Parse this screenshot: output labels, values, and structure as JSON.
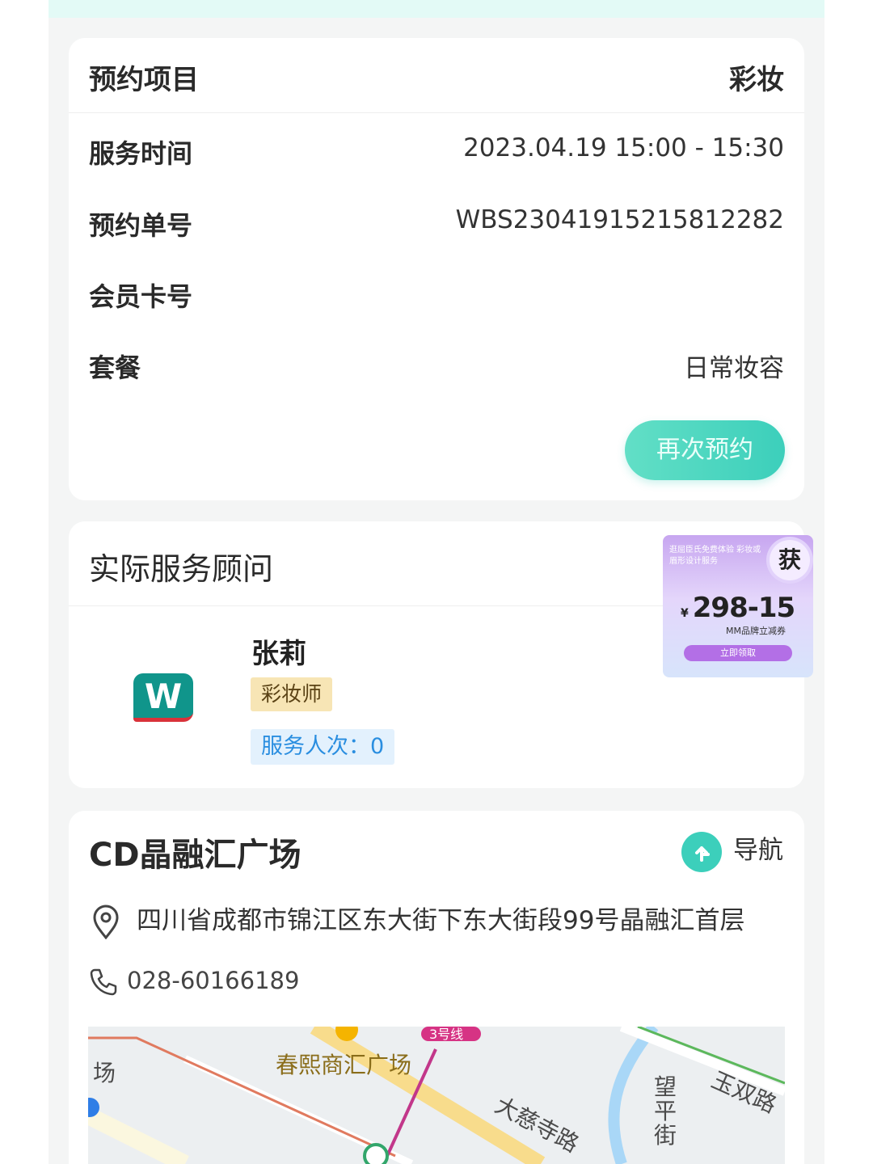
{
  "booking": {
    "header_label": "预约项目",
    "header_value": "彩妆",
    "rows": [
      {
        "label": "服务时间",
        "value": "2023.04.19 15:00 - 15:30"
      },
      {
        "label": "预约单号",
        "value": "WBS23041915215812282"
      },
      {
        "label": "会员卡号",
        "value": ""
      },
      {
        "label": "套餐",
        "value": "日常妆容"
      }
    ],
    "rebook_label": "再次预约"
  },
  "consultant": {
    "title": "实际服务顾问",
    "logo_text": "W",
    "name": "张莉",
    "role": "彩妆师",
    "service_count": "服务人次：0"
  },
  "promo": {
    "top_text": "逛屈臣氏免费体验 彩妆或眉形设计服务",
    "badge": "获",
    "currency": "¥",
    "amount": "298-15",
    "subtitle": "MM品牌立减券",
    "button": "立即领取"
  },
  "store": {
    "name": "CD晶融汇广场",
    "nav_label": "导航",
    "address": "四川省成都市锦江区东大街下东大街段99号晶融汇首层",
    "phone": "028-60166189",
    "map": {
      "labels": {
        "plaza_partial": "场",
        "chunxi": "春熙商汇广场",
        "metro": "3号线",
        "dacisi": "大慈寺路",
        "wangping": "望平街",
        "yushuang": "玉双路"
      }
    }
  },
  "colors": {
    "accent": "#3ccfbb",
    "role_tag_bg": "#f7e5b5",
    "count_tag_bg": "#e3f1fd",
    "count_tag_text": "#2a8ee0"
  },
  "icons": [
    "navigation-icon",
    "location-pin-icon",
    "phone-icon",
    "watsons-logo"
  ]
}
